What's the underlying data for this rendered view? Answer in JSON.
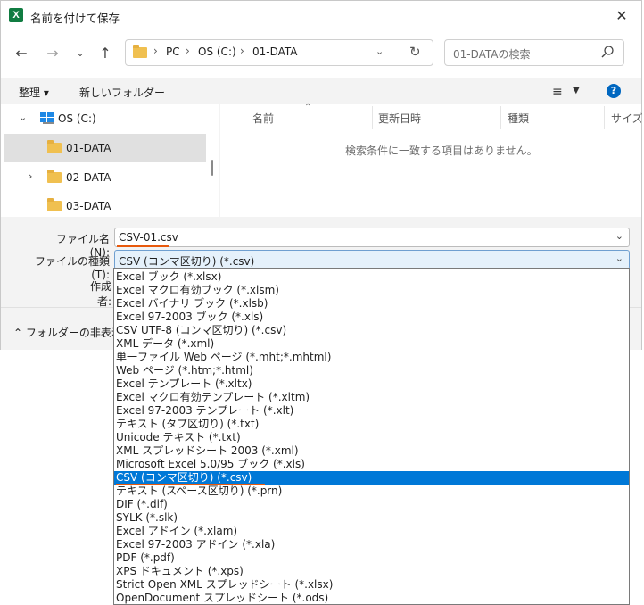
{
  "window": {
    "title": "名前を付けて保存",
    "app_icon_letter": "X"
  },
  "nav": {
    "crumbs": [
      "PC",
      "OS (C:)",
      "01-DATA"
    ],
    "search_placeholder": "01-DATAの検索"
  },
  "toolbar": {
    "organize_label": "整理 ▾",
    "new_folder_label": "新しいフォルダー"
  },
  "tree": {
    "items": [
      {
        "label": "OS (C:)",
        "expanded": true,
        "type": "drive"
      },
      {
        "label": "01-DATA",
        "selected": true,
        "type": "folder"
      },
      {
        "label": "02-DATA",
        "type": "folder"
      },
      {
        "label": "03-DATA",
        "type": "folder"
      }
    ]
  },
  "filelist": {
    "columns": [
      "名前",
      "更新日時",
      "種類",
      "サイズ"
    ],
    "empty_message": "検索条件に一致する項目はありません。"
  },
  "form": {
    "filename_label": "ファイル名(N):",
    "filename_value": "CSV-01.csv",
    "filetype_label": "ファイルの種類(T):",
    "filetype_value": "CSV (コンマ区切り) (*.csv)",
    "author_label": "作成者:"
  },
  "footer": {
    "hide_folders_label": "フォルダーの非表示"
  },
  "filetype_options": [
    "Excel ブック (*.xlsx)",
    "Excel マクロ有効ブック (*.xlsm)",
    "Excel バイナリ ブック (*.xlsb)",
    "Excel 97-2003 ブック (*.xls)",
    "CSV UTF-8 (コンマ区切り) (*.csv)",
    "XML データ (*.xml)",
    "単一ファイル Web ページ (*.mht;*.mhtml)",
    "Web ページ (*.htm;*.html)",
    "Excel テンプレート (*.xltx)",
    "Excel マクロ有効テンプレート (*.xltm)",
    "Excel 97-2003 テンプレート (*.xlt)",
    "テキスト (タブ区切り) (*.txt)",
    "Unicode テキスト (*.txt)",
    "XML スプレッドシート 2003 (*.xml)",
    "Microsoft Excel 5.0/95 ブック (*.xls)",
    "CSV (コンマ区切り) (*.csv)",
    "テキスト (スペース区切り) (*.prn)",
    "DIF (*.dif)",
    "SYLK (*.slk)",
    "Excel アドイン (*.xlam)",
    "Excel 97-2003 アドイン (*.xla)",
    "PDF (*.pdf)",
    "XPS ドキュメント (*.xps)",
    "Strict Open XML スプレッドシート (*.xlsx)",
    "OpenDocument スプレッドシート (*.ods)"
  ],
  "selected_option_index": 15,
  "colors": {
    "accent": "#0078d7",
    "highlight_underline": "#e8590c",
    "excel_green": "#107c41"
  }
}
